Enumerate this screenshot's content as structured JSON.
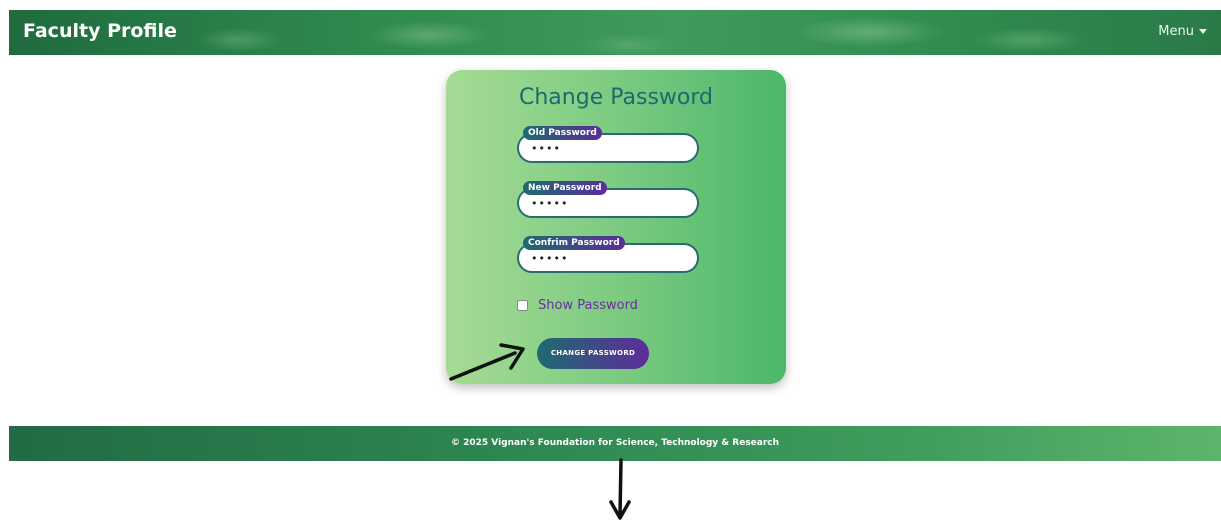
{
  "navbar": {
    "brand": "Faculty Profile",
    "menu_label": "Menu"
  },
  "form": {
    "title": "Change Password",
    "old_password": {
      "label": "Old Password",
      "value": "••••"
    },
    "new_password": {
      "label": "New Password",
      "value": "•••••"
    },
    "confirm_password": {
      "label": "Confrim Password",
      "value": "•••••"
    },
    "show_password_label": "Show Password",
    "show_password_checked": false,
    "submit_label": "CHANGE PASSWORD"
  },
  "footer": {
    "text": "© 2025 Vignan's Foundation for Science, Technology & Research"
  },
  "colors": {
    "title": "#1c6a70",
    "tag": "#6a2f9c",
    "button_start": "#1f6a70",
    "button_end": "#5e2c9a"
  }
}
